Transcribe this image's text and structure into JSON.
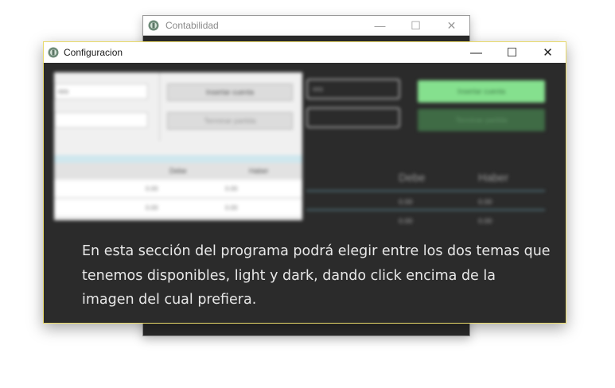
{
  "background_window": {
    "title": "Contabilidad",
    "controls": {
      "minimize": "—",
      "maximize": "☐",
      "close": "✕"
    }
  },
  "dialog": {
    "title": "Configuracion",
    "controls": {
      "minimize": "—",
      "maximize": "☐",
      "close": "✕"
    }
  },
  "light_preview": {
    "input_1": "nro",
    "insert_button": "Insertar cuenta",
    "finish_button": "Terminar partida",
    "columns": [
      "Debe",
      "Haber"
    ],
    "rows": [
      [
        "0.00",
        "0.00"
      ],
      [
        "0.00",
        "0.00"
      ]
    ]
  },
  "dark_preview": {
    "input_1": "nro",
    "insert_button": "Insertar cuenta",
    "finish_button": "Terminar partida",
    "columns": [
      "Debe",
      "Haber"
    ],
    "rows": [
      [
        "0.00",
        "0.00"
      ],
      [
        "0.00",
        "0.00"
      ]
    ]
  },
  "description": "En esta sección del programa podrá elegir entre los dos temas que tenemos disponibles, light y dark, dando click encima de la imagen del cual prefiera.",
  "colors": {
    "dark_bg": "#2b2b2b",
    "accent_green": "#85e08e",
    "dialog_border": "#e8d96a"
  }
}
